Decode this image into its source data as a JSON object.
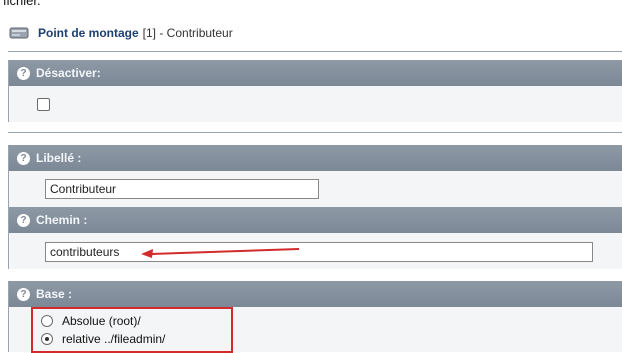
{
  "top_cut_text": "fichier.",
  "record": {
    "title_bold": "Point de montage",
    "title_rest": "[1] - Contributeur"
  },
  "fields": {
    "disable": {
      "label": "Désactiver:",
      "checked": false
    },
    "title": {
      "label": "Libellé :",
      "value": "Contributeur"
    },
    "path": {
      "label": "Chemin :",
      "value": "contributeurs"
    },
    "base": {
      "label": "Base :",
      "options": [
        {
          "label": "Absolue (root)/",
          "checked": false
        },
        {
          "label": "relative ../fileadmin/",
          "checked": true
        }
      ]
    }
  },
  "colors": {
    "header_bg": "#8e99a6",
    "header_text": "#f3f6fa",
    "annotation_red": "#d12b2b",
    "title_blue": "#1d3f73"
  }
}
